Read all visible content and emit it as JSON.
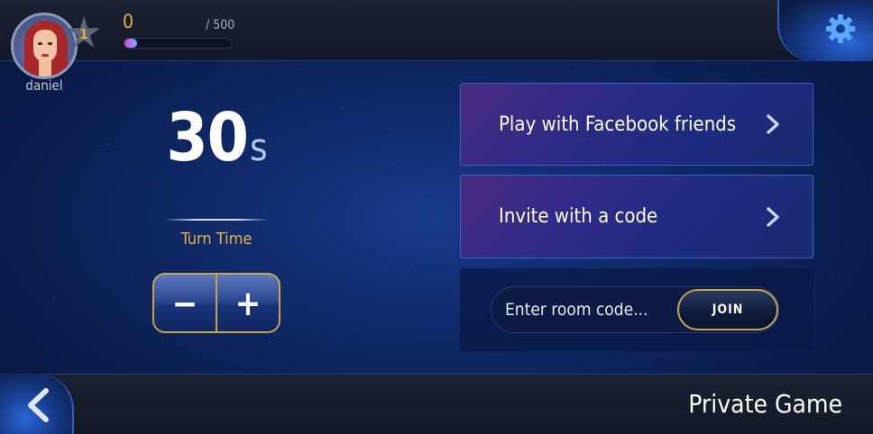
{
  "player": {
    "username": "daniel",
    "level": "1",
    "xp_current": "0",
    "xp_max": "/ 500",
    "xp_progress_fraction": 0.12
  },
  "timer": {
    "value": "30",
    "unit": "s",
    "label": "Turn Time",
    "decrease_symbol": "−",
    "increase_symbol": "+"
  },
  "menu": {
    "facebook_label": "Play with Facebook friends",
    "invite_label": "Invite with a code"
  },
  "join": {
    "placeholder": "Enter room code...",
    "button_label": "JOIN"
  },
  "footer": {
    "title": "Private Game"
  },
  "icons": {
    "settings": "gear-icon",
    "back": "chevron-left-icon",
    "card_arrow": "chevron-right-icon",
    "level": "star-icon"
  },
  "colors": {
    "accent_gold": "#e3b43c",
    "button_border": "#c8a54a",
    "bar_start": "#e243d6",
    "bar_end": "#6fb2ff"
  }
}
